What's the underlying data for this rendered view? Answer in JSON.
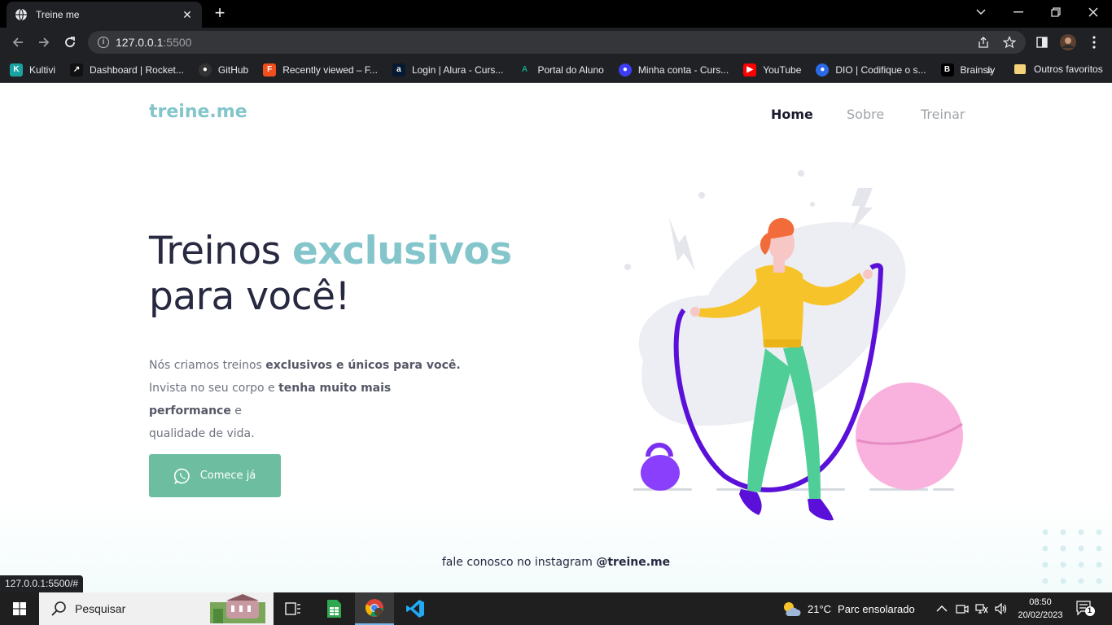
{
  "browser": {
    "tab_title": "Treine me",
    "url_host": "127.0.0.1",
    "url_port": ":5500",
    "status_url": "127.0.0.1:5500/#",
    "bookmarks": [
      {
        "label": "Kultivi",
        "color": "#1aa3a3"
      },
      {
        "label": "Dashboard | Rocket...",
        "color": "#111111"
      },
      {
        "label": "GitHub",
        "color": "#333333"
      },
      {
        "label": "Recently viewed – F...",
        "color": "#f24e1e"
      },
      {
        "label": "Login | Alura - Curs...",
        "color": "#051933"
      },
      {
        "label": "Portal do Aluno",
        "color": "#12a38a"
      },
      {
        "label": "Minha conta - Curs...",
        "color": "#3d3df5"
      },
      {
        "label": "YouTube",
        "color": "#ff0000"
      },
      {
        "label": "DIO | Codifique o s...",
        "color": "#2a6ae6"
      },
      {
        "label": "Brainsly",
        "color": "#000000"
      }
    ],
    "bookmarks_more": "»",
    "other_bookmarks": "Outros favoritos"
  },
  "site": {
    "logo": "treine.me",
    "nav": [
      "Home",
      "Sobre",
      "Treinar"
    ],
    "hero": {
      "title_part1": "Treinos ",
      "title_accent": "exclusivos",
      "title_part2": "para você!",
      "p1_text": "Nós criamos treinos ",
      "p1_bold": "exclusivos e únicos para você.",
      "p2_text": "Invista no seu corpo e ",
      "p2_bold": "tenha muito mais performance",
      "p2_end": " e",
      "p3_text": "qualidade de vida."
    },
    "cta_label": "Comece já",
    "footer_text": "fale conosco no instagram ",
    "footer_handle": "@treine.me"
  },
  "taskbar": {
    "search_placeholder": "Pesquisar",
    "temperature": "21°C",
    "weather_text": "Parc ensolarado",
    "time": "08:50",
    "date": "20/02/2023",
    "notification_count": "1"
  },
  "colors": {
    "accent": "#83c5cb",
    "cta": "#6dbea1",
    "heading": "#262940"
  }
}
